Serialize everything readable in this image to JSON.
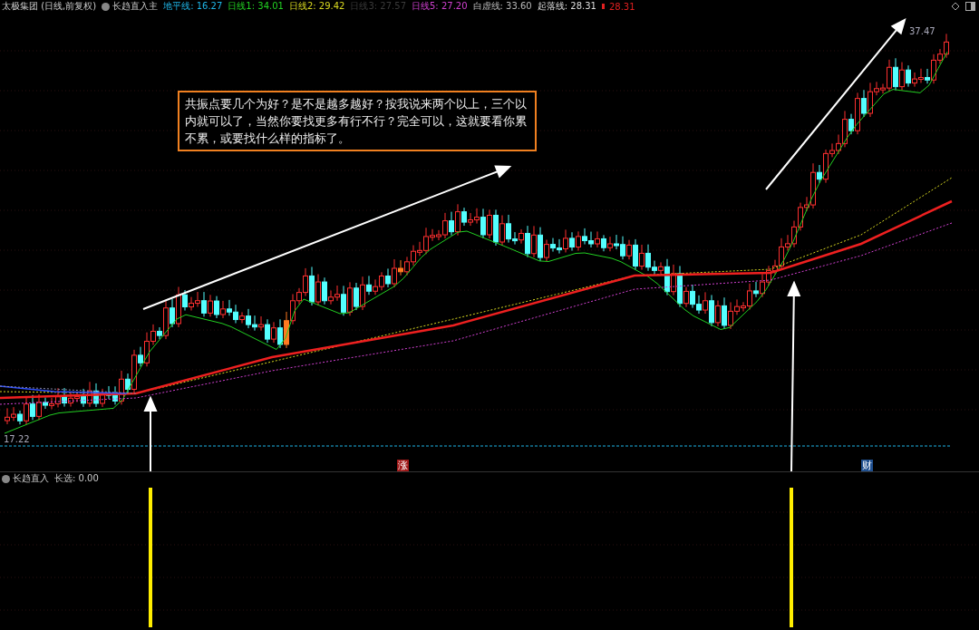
{
  "header": {
    "title": "太极集团 (日线,前复权)",
    "indicator": "长趋直入主",
    "legend": [
      {
        "label": "地平线:",
        "value": "16.27",
        "color": "#1fb6e8"
      },
      {
        "label": "日线1:",
        "value": "34.01",
        "color": "#22d022"
      },
      {
        "label": "日线2:",
        "value": "29.42",
        "color": "#d8d820"
      },
      {
        "label": "日线3:",
        "value": "27.57",
        "color": "#3a3a3a"
      },
      {
        "label": "日线5:",
        "value": "27.20",
        "color": "#d040d0"
      },
      {
        "label": "白虚线:",
        "value": "33.60",
        "color": "#b8b8b8"
      },
      {
        "label": "起落线:",
        "value": "28.31",
        "color": "#dddddd"
      },
      {
        "value": "28.31",
        "color": "#e02020"
      }
    ]
  },
  "annotation": {
    "text": "共振点要几个为好？是不是越多越好？按我说来两个以上，三个以内就可以了，当然你要找更多有行不行？完全可以，这就要看你累不累，或要找什么样的指标了。"
  },
  "price_labels": {
    "high": "37.47",
    "low": "17.22"
  },
  "markers": [
    {
      "text": "涨",
      "color": "#a01818"
    },
    {
      "text": "财",
      "color": "#1f4f8f"
    }
  ],
  "sub_panel": {
    "indicator": "长趋直入",
    "legend": [
      {
        "label": "长选:",
        "value": "0.00"
      }
    ]
  }
}
